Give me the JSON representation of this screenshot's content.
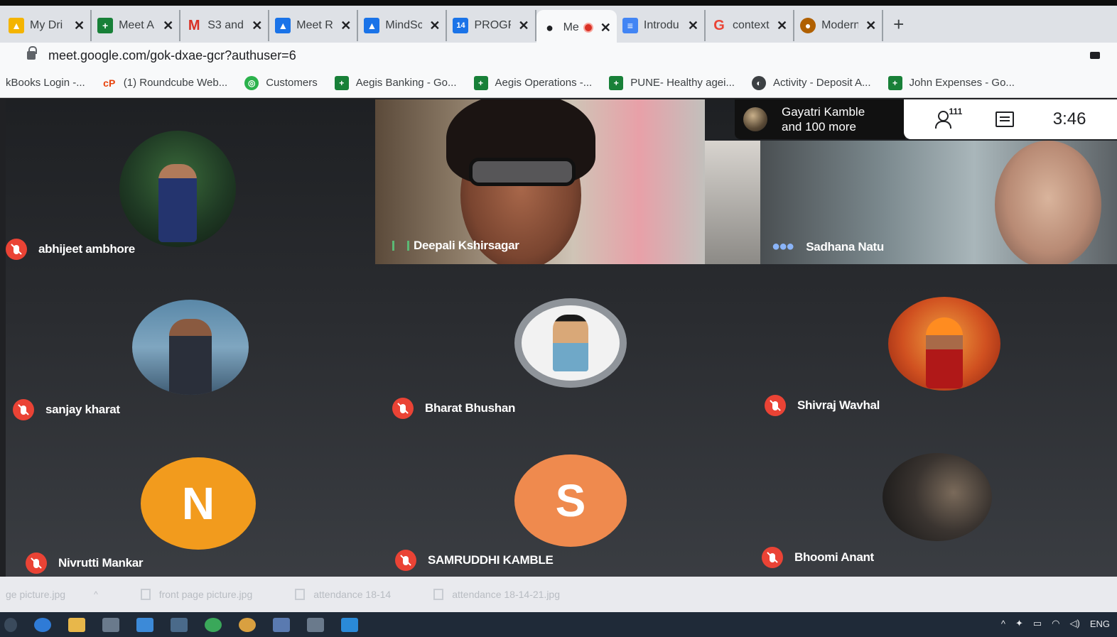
{
  "browser": {
    "tabs": [
      {
        "label": "My Dri",
        "icon": "drive-icon",
        "color": "#f4b400"
      },
      {
        "label": "Meet A",
        "icon": "sheets-icon",
        "color": "#188038"
      },
      {
        "label": "S3 and",
        "icon": "gmail-icon",
        "color": "#d93025"
      },
      {
        "label": "Meet R",
        "icon": "drive-icon",
        "color": "#1a73e8"
      },
      {
        "label": "MindSc",
        "icon": "drive-icon",
        "color": "#1a73e8"
      },
      {
        "label": "PROGR",
        "icon": "calendar-icon",
        "color": "#1a73e8"
      },
      {
        "label": "Me",
        "icon": "meet-icon",
        "color": "#202124",
        "active": true
      },
      {
        "label": "Introdu",
        "icon": "docs-icon",
        "color": "#4285f4"
      },
      {
        "label": "context",
        "icon": "google-icon",
        "color": "#ea4335"
      },
      {
        "label": "Modern",
        "icon": "site-icon",
        "color": "#b06000"
      }
    ],
    "close_glyph": "✕",
    "new_tab": "+",
    "url": "meet.google.com/gok-dxae-gcr?authuser=6",
    "bookmarks": [
      {
        "label": "kBooks Login -...",
        "icon": "",
        "color": "#f8f9fa"
      },
      {
        "label": "(1) Roundcube Web...",
        "icon": "cP",
        "color": "#e8430d"
      },
      {
        "label": "Customers",
        "icon": "◎",
        "color": "#2bb24c"
      },
      {
        "label": "Aegis Banking - Go...",
        "icon": "+",
        "color": "#188038"
      },
      {
        "label": "Aegis Operations -...",
        "icon": "+",
        "color": "#188038"
      },
      {
        "label": "PUNE- Healthy agei...",
        "icon": "+",
        "color": "#188038"
      },
      {
        "label": "Activity - Deposit A...",
        "icon": "◐",
        "color": "#3c4043"
      },
      {
        "label": "John Expenses - Go...",
        "icon": "+",
        "color": "#188038"
      }
    ]
  },
  "meet": {
    "presenter_chip": {
      "line1": "Gayatri Kamble",
      "line2": "and 100 more"
    },
    "participant_count": "111",
    "time": "3:46",
    "tiles": {
      "deepali": "Deepali Kshirsagar",
      "sadhana": "Sadhana Natu",
      "abhijeet": "abhijeet ambhore",
      "sanjay": "sanjay kharat",
      "bharat": "Bharat Bhushan",
      "shivraj": "Shivraj Wavhal",
      "nivrutti": "Nivrutti Mankar",
      "nivrutti_initial": "N",
      "samruddhi": "SAMRUDDHI KAMBLE",
      "samruddhi_initial": "S",
      "bhoomi": "Bhoomi Anant"
    },
    "colors": {
      "muted": "#ea4335",
      "avatar_n": "#f29b1d",
      "avatar_s": "#ef8a4e"
    }
  },
  "downloads": [
    "ge picture.jpg",
    "front page picture.jpg",
    "attendance 18-14",
    "attendance 18-14-21.jpg"
  ],
  "taskbar": {
    "lang": "ENG"
  }
}
